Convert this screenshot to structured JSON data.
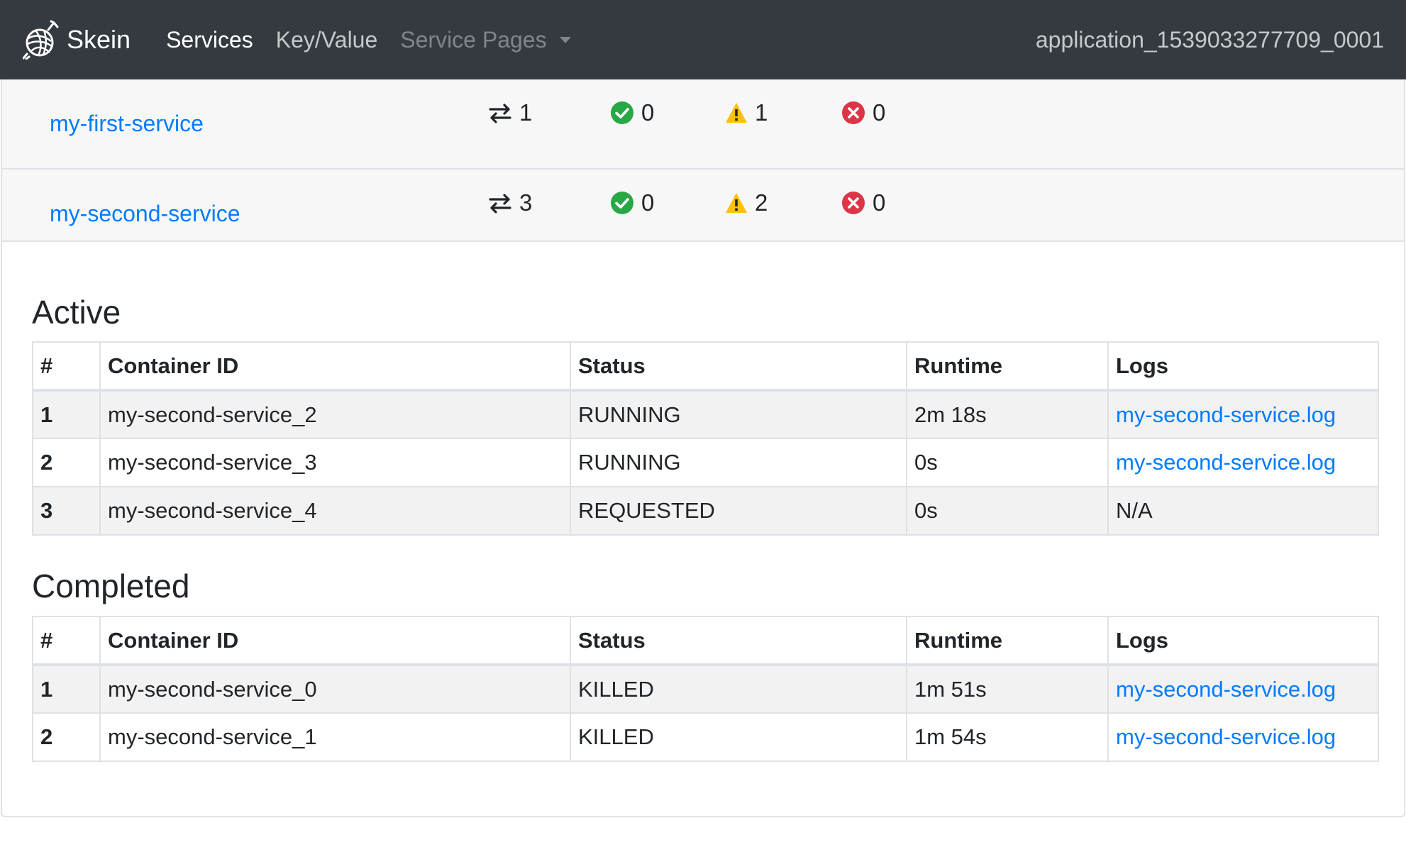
{
  "navbar": {
    "brand": "Skein",
    "brand_icon": "skein-yarn-icon",
    "links": [
      {
        "label": "Services",
        "active": true
      },
      {
        "label": "Key/Value",
        "active": false
      },
      {
        "label": "Service Pages",
        "disabled": true
      }
    ],
    "app_id": "application_1539033277709_0001"
  },
  "services": [
    {
      "name": "my-first-service",
      "total": "1",
      "succeeded": "0",
      "warnings": "1",
      "failed": "0"
    },
    {
      "name": "my-second-service",
      "total": "3",
      "succeeded": "0",
      "warnings": "2",
      "failed": "0"
    }
  ],
  "icons": {
    "total": "exchange-arrows-icon",
    "succeeded": "check-circle-icon",
    "warnings": "warning-triangle-icon",
    "failed": "x-circle-icon"
  },
  "colors": {
    "navbar_bg": "#343a40",
    "link": "#007bff",
    "success": "#28a745",
    "warning": "#ffc107",
    "danger": "#dc3545"
  },
  "active": {
    "title": "Active",
    "headers": [
      "#",
      "Container ID",
      "Status",
      "Runtime",
      "Logs"
    ],
    "rows": [
      {
        "idx": "1",
        "id": "my-second-service_2",
        "status": "RUNNING",
        "runtime": "2m 18s",
        "logs": "my-second-service.log",
        "logs_link": true
      },
      {
        "idx": "2",
        "id": "my-second-service_3",
        "status": "RUNNING",
        "runtime": "0s",
        "logs": "my-second-service.log",
        "logs_link": true
      },
      {
        "idx": "3",
        "id": "my-second-service_4",
        "status": "REQUESTED",
        "runtime": "0s",
        "logs": "N/A",
        "logs_link": false
      }
    ]
  },
  "completed": {
    "title": "Completed",
    "headers": [
      "#",
      "Container ID",
      "Status",
      "Runtime",
      "Logs"
    ],
    "rows": [
      {
        "idx": "1",
        "id": "my-second-service_0",
        "status": "KILLED",
        "runtime": "1m 51s",
        "logs": "my-second-service.log",
        "logs_link": true
      },
      {
        "idx": "2",
        "id": "my-second-service_1",
        "status": "KILLED",
        "runtime": "1m 54s",
        "logs": "my-second-service.log",
        "logs_link": true
      }
    ]
  }
}
